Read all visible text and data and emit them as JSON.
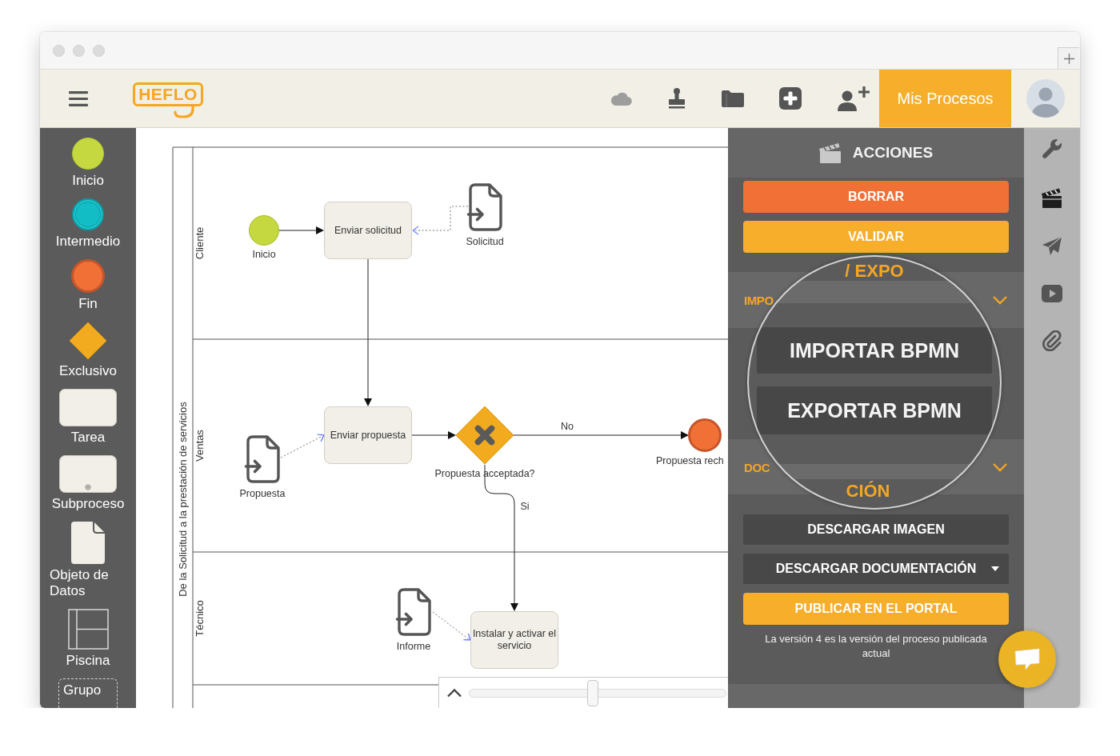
{
  "header": {
    "logo": "HEFLO",
    "primary_button": "Mis Procesos"
  },
  "palette": [
    {
      "kind": "start",
      "label": "Inicio"
    },
    {
      "kind": "intermediate",
      "label": "Intermedio"
    },
    {
      "kind": "end",
      "label": "Fin"
    },
    {
      "kind": "gateway",
      "label": "Exclusivo"
    },
    {
      "kind": "task",
      "label": "Tarea"
    },
    {
      "kind": "subprocess",
      "label": "Subproceso"
    },
    {
      "kind": "data",
      "label": "Objeto de Datos"
    },
    {
      "kind": "pool",
      "label": "Piscina"
    },
    {
      "kind": "group",
      "label": "Grupo"
    }
  ],
  "diagram": {
    "pool": {
      "label": "De la Solicitud a la prestación de servicios"
    },
    "lanes": [
      {
        "label": "Cliente"
      },
      {
        "label": "Ventas"
      },
      {
        "label": "Técnico"
      }
    ],
    "nodes": [
      {
        "kind": "start",
        "label": "Inicio"
      },
      {
        "kind": "task",
        "label": "Enviar solicitud"
      },
      {
        "kind": "data",
        "label": "Solicitud"
      },
      {
        "kind": "data",
        "label": "Propuesta"
      },
      {
        "kind": "task",
        "label": "Enviar propuesta"
      },
      {
        "kind": "gateway",
        "label": "Propuesta acceptada?"
      },
      {
        "kind": "end",
        "label": "Propuesta rech"
      },
      {
        "kind": "data",
        "label": "Informe"
      },
      {
        "kind": "task",
        "label": "Instalar y activar el servicio"
      }
    ],
    "flows": [
      {
        "kind": "sequence"
      },
      {
        "kind": "association"
      },
      {
        "kind": "sequence"
      },
      {
        "kind": "association"
      },
      {
        "kind": "sequence"
      },
      {
        "kind": "sequence",
        "label": "No"
      },
      {
        "kind": "sequence",
        "label": "Si"
      },
      {
        "kind": "association"
      }
    ]
  },
  "zoom_control": {
    "level": 0.48
  },
  "actions_panel": {
    "title": "ACCIONES",
    "top_buttons": [
      {
        "label": "BORRAR",
        "kind": "danger"
      },
      {
        "label": "VALIDAR",
        "kind": "accent"
      }
    ],
    "sections": [
      {
        "title": "IMPO"
      },
      {
        "title": "DOC"
      }
    ],
    "lens": {
      "heading_top": "/ EXPO",
      "buttons": [
        {
          "label": "IMPORTAR BPMN",
          "kind": "dark"
        },
        {
          "label": "EXPORTAR BPMN",
          "kind": "dark"
        }
      ],
      "heading_bottom": "CIÓN"
    },
    "bottom_buttons": [
      {
        "label": "DESCARGAR IMAGEN",
        "kind": "dark"
      },
      {
        "label": "DESCARGAR DOCUMENTACIÓN",
        "kind": "dropdown"
      },
      {
        "label": "PUBLICAR EN EL PORTAL",
        "kind": "accent"
      }
    ],
    "note": "La versión 4 es la versión del proceso publicada actual"
  }
}
